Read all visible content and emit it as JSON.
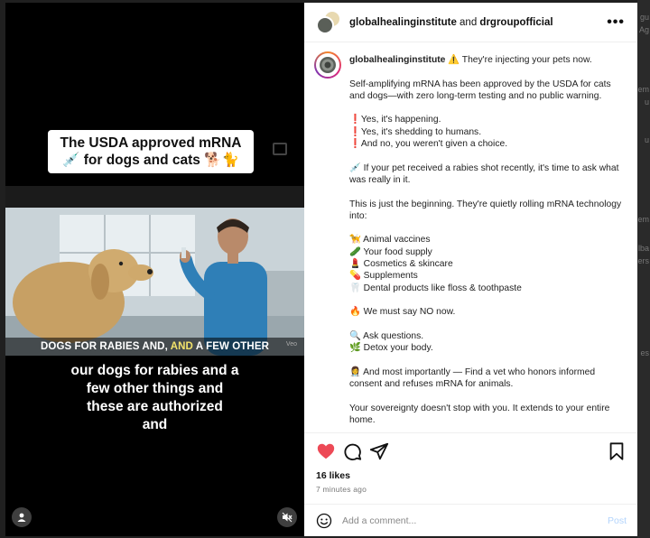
{
  "backdrop": {
    "edge_fragments": [
      "gu",
      "Ag",
      "em",
      "u",
      "u",
      "em",
      "lba",
      "ers",
      "es"
    ]
  },
  "video": {
    "caption_line1": "The USDA approved mRNA",
    "caption_line2": "💉 for dogs and cats 🐕🐈",
    "subtitle_strip_pre": "DOGS FOR RABIES AND, ",
    "subtitle_strip_highlight": "AND",
    "subtitle_strip_post": " A FEW OTHER",
    "watermark": "Veo",
    "subtitle_lines": [
      "our dogs for rabies and a",
      "few other things and",
      "these are authorized",
      "and"
    ]
  },
  "header": {
    "account1": "globalhealinginstitute",
    "joiner": " and ",
    "account2": "drgroupofficial",
    "more_label": "•••"
  },
  "caption": {
    "author": "globalhealinginstitute",
    "headline": "⚠️ They're injecting your pets now.",
    "p1": "Self-amplifying mRNA has been approved by the USDA for cats and dogs—with zero long-term testing and no public warning.",
    "list1": [
      "❗Yes, it's happening.",
      "❗Yes, it's shedding to humans.",
      "❗And no, you weren't given a choice."
    ],
    "p2": "💉 If your pet received a rabies shot recently, it's time to ask what was really in it.",
    "p3": "This is just the beginning. They're quietly rolling mRNA technology into:",
    "list2": [
      "🦮 Animal vaccines",
      "🥒 Your food supply",
      "💄 Cosmetics & skincare",
      "💊 Supplements",
      "🦷 Dental products like floss & toothpaste"
    ],
    "p4": "🔥 We must say NO now.",
    "list3": [
      "🔍 Ask questions.",
      "🌿 Detox your body."
    ],
    "p5": "👩‍⚕️ And most importantly — Find a vet who honors informed consent and refuses mRNA for animals.",
    "p6": "Your sovereignty doesn't stop with you. It extends to your entire home."
  },
  "actions": {
    "likes": "16 likes",
    "time": "7 minutes ago",
    "like_color": "#ed4956"
  },
  "comment": {
    "placeholder": "Add a comment...",
    "post_label": "Post",
    "post_color": "#b3d4fc"
  }
}
